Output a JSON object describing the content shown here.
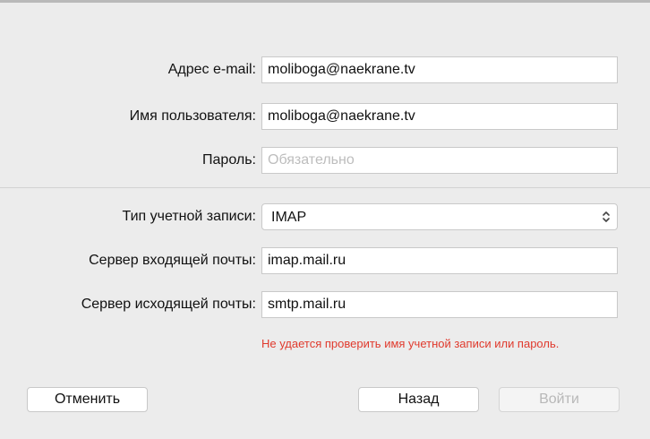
{
  "form": {
    "email": {
      "label": "Адрес e-mail:",
      "value": "moliboga@naekrane.tv"
    },
    "username": {
      "label": "Имя пользователя:",
      "value": "moliboga@naekrane.tv"
    },
    "password": {
      "label": "Пароль:",
      "value": "",
      "placeholder": "Обязательно"
    },
    "account_type": {
      "label": "Тип учетной записи:",
      "value": "IMAP",
      "icon": "chevron-up-down-icon"
    },
    "incoming_server": {
      "label": "Сервер входящей почты:",
      "value": "imap.mail.ru"
    },
    "outgoing_server": {
      "label": "Сервер исходящей почты:",
      "value": "smtp.mail.ru"
    }
  },
  "error": {
    "message": "Не удается проверить имя учетной записи или пароль.",
    "color": "#e03a2d"
  },
  "buttons": {
    "cancel": "Отменить",
    "back": "Назад",
    "sign_in": "Войти"
  }
}
